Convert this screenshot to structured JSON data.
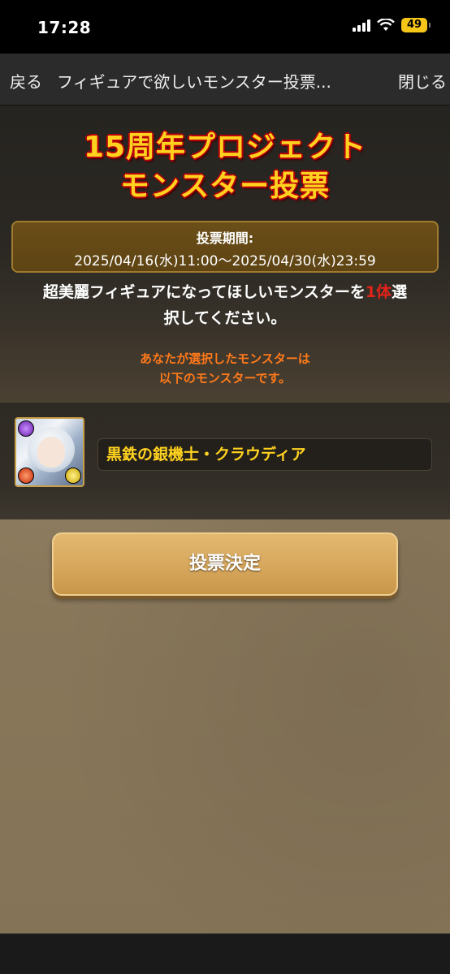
{
  "status_bar": {
    "time": "17:28",
    "battery": "49"
  },
  "nav": {
    "back_label": "戻る",
    "title": "フィギュアで欲しいモンスター投票...",
    "close_label": "閉じる"
  },
  "header": {
    "title_line1": "15周年プロジェクト",
    "title_line2": "モンスター投票",
    "period_label": "投票期間:",
    "period_range": "2025/04/16(水)11:00〜2025/04/30(水)23:59",
    "instruction_pre": "超美麗フィギュアになってほしいモンスターを",
    "instruction_count": "1体",
    "instruction_post1": "選",
    "instruction_line2": "択してください。"
  },
  "selection": {
    "line1": "あなたが選択したモンスターは",
    "line2": "以下のモンスターです。",
    "monster_name": "黒鉄の銀機士・クラウディア"
  },
  "vote_button_label": "投票決定",
  "colors": {
    "title_yellow": "#ffd21f",
    "title_outline": "#b8000a",
    "notice_orange": "#ff7a1a",
    "count_red": "#e2231a",
    "button": "#d7a75c"
  }
}
